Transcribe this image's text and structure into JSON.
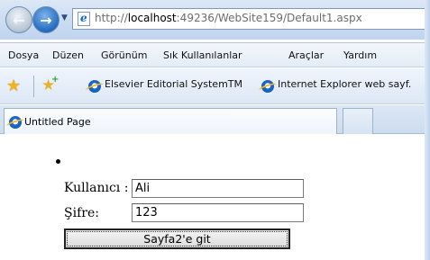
{
  "browser": {
    "address": {
      "prefix": "http://",
      "host": "localhost",
      "rest": ":49236/WebSite159/Default1.aspx"
    },
    "menu": [
      "Dosya",
      "Düzen",
      "Görünüm",
      "Sık Kullanılanlar",
      "Araçlar",
      "Yardım"
    ],
    "favorites": [
      "Elsevier Editorial SystemTM",
      "Internet Explorer web sayf."
    ],
    "tab_title": "Untitled Page",
    "icons": {
      "back": "back-arrow-icon",
      "forward": "forward-arrow-icon",
      "favorites": "star-icon",
      "add_favorite": "add-favorite-icon",
      "ie": "internet-explorer-icon"
    }
  },
  "form": {
    "user_label": "Kullanıcı :",
    "user_value": "Ali",
    "password_label": "Şifre:",
    "password_value": "123",
    "submit_label": "Sayfa2'e git"
  }
}
